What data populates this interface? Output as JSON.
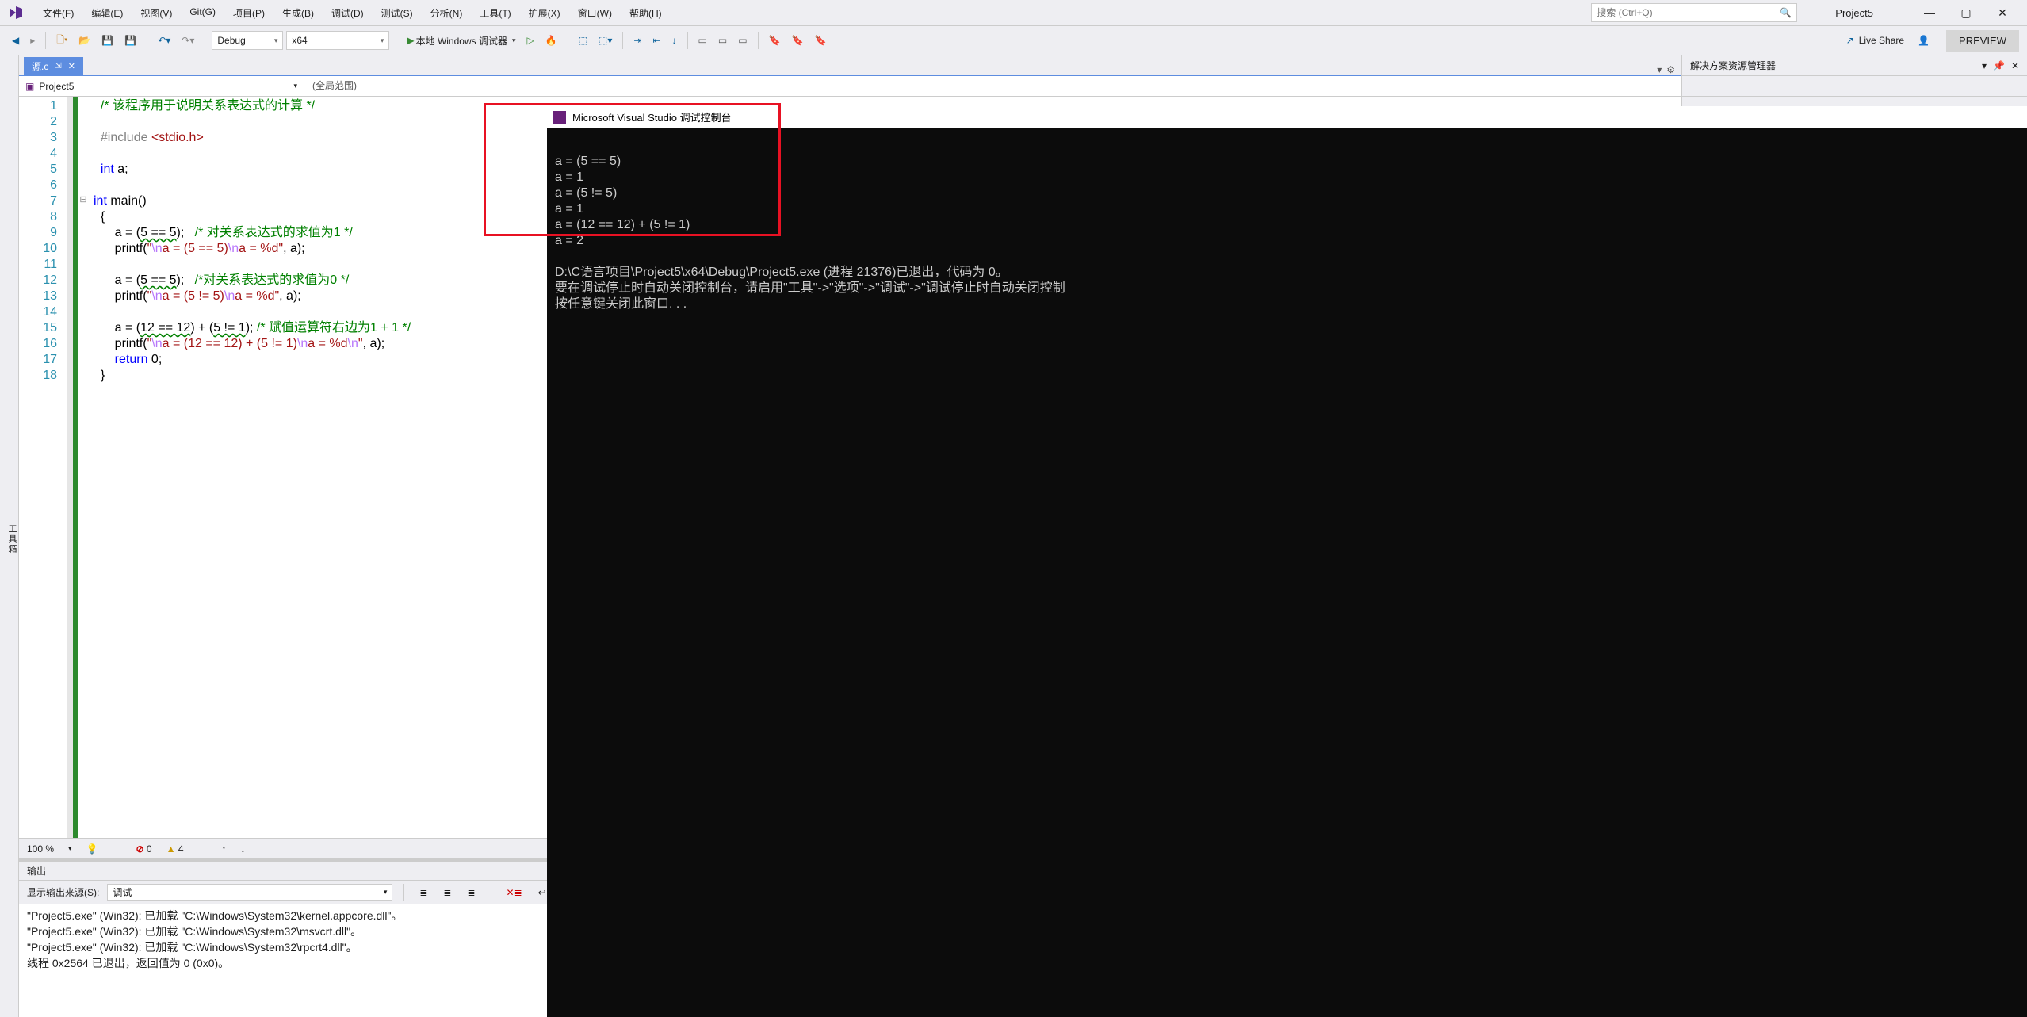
{
  "menus": [
    "文件(F)",
    "编辑(E)",
    "视图(V)",
    "Git(G)",
    "项目(P)",
    "生成(B)",
    "调试(D)",
    "测试(S)",
    "分析(N)",
    "工具(T)",
    "扩展(X)",
    "窗口(W)",
    "帮助(H)"
  ],
  "search_placeholder": "搜索 (Ctrl+Q)",
  "project_name": "Project5",
  "toolbar": {
    "config": "Debug",
    "platform": "x64",
    "run_label": "本地 Windows 调试器",
    "live_share": "Live Share",
    "preview": "PREVIEW"
  },
  "left_tool": "工具箱",
  "tab": {
    "name": "源.c",
    "pin": "�î",
    "close": "✕"
  },
  "scope": {
    "project": "Project5",
    "scope2": "(全局范围)"
  },
  "code": {
    "lines": [
      {
        "n": 1,
        "html": "  <span class='cmt'>/* 该程序用于说明关系表达式的计算 */</span>"
      },
      {
        "n": 2,
        "html": ""
      },
      {
        "n": 3,
        "html": "  <span class='inc'>#include</span> <span class='incname'>&lt;stdio.h&gt;</span>"
      },
      {
        "n": 4,
        "html": ""
      },
      {
        "n": 5,
        "html": "  <span class='kw'>int</span> a;"
      },
      {
        "n": 6,
        "html": ""
      },
      {
        "n": 7,
        "html": "<span class='kw'>int</span> main()",
        "fold": "⊟"
      },
      {
        "n": 8,
        "html": "  {"
      },
      {
        "n": 9,
        "html": "      a = (<span class='wavy'>5 == 5</span>);   <span class='cmt'>/* 对关系表达式的求值为1 */</span>"
      },
      {
        "n": 10,
        "html": "      printf(<span class='str'>\"</span><span class='esc'>\\n</span><span class='str'>a = (5 == 5)</span><span class='esc'>\\n</span><span class='str'>a = %d\"</span>, a);"
      },
      {
        "n": 11,
        "html": ""
      },
      {
        "n": 12,
        "html": "      a = (<span class='wavy'>5 == 5</span>);   <span class='cmt'>/*对关系表达式的求值为0 */</span>"
      },
      {
        "n": 13,
        "html": "      printf(<span class='str'>\"</span><span class='esc'>\\n</span><span class='str'>a = (5 != 5)</span><span class='esc'>\\n</span><span class='str'>a = %d\"</span>, a);"
      },
      {
        "n": 14,
        "html": ""
      },
      {
        "n": 15,
        "html": "      a = (<span class='wavy'>12 == 12</span>) + (<span class='wavy'>5 != 1</span>); <span class='cmt'>/* 赋值运算符右边为1 + 1 */</span>"
      },
      {
        "n": 16,
        "html": "      printf(<span class='str'>\"</span><span class='esc'>\\n</span><span class='str'>a = (12 == 12) + (5 != 1)</span><span class='esc'>\\n</span><span class='str'>a = %d</span><span class='esc'>\\n</span><span class='str'>\"</span>, a);"
      },
      {
        "n": 17,
        "html": "      <span class='kw'>return</span> 0;"
      },
      {
        "n": 18,
        "html": "  }"
      }
    ]
  },
  "ed_status": {
    "zoom": "100 %",
    "errors": "0",
    "warnings": "4"
  },
  "output": {
    "title": "输出",
    "src_label": "显示输出来源(S):",
    "src_value": "调试",
    "lines": [
      "\"Project5.exe\" (Win32): 已加载 \"C:\\Windows\\System32\\kernel.appcore.dll\"。",
      "\"Project5.exe\" (Win32): 已加载 \"C:\\Windows\\System32\\msvcrt.dll\"。",
      "\"Project5.exe\" (Win32): 已加载 \"C:\\Windows\\System32\\rpcrt4.dll\"。",
      "线程 0x2564 已退出，返回值为 0 (0x0)。"
    ]
  },
  "right_panel": {
    "title": "解决方案资源管理器"
  },
  "console": {
    "title": "Microsoft Visual Studio 调试控制台",
    "lines": [
      "",
      "a = (5 == 5)",
      "a = 1",
      "a = (5 != 5)",
      "a = 1",
      "a = (12 == 12) + (5 != 1)",
      "a = 2",
      "",
      "D:\\C语言项目\\Project5\\x64\\Debug\\Project5.exe (进程 21376)已退出，代码为 0。",
      "要在调试停止时自动关闭控制台，请启用\"工具\"->\"选项\"->\"调试\"->\"调试停止时自动关闭控制",
      "按任意键关闭此窗口. . ."
    ]
  }
}
